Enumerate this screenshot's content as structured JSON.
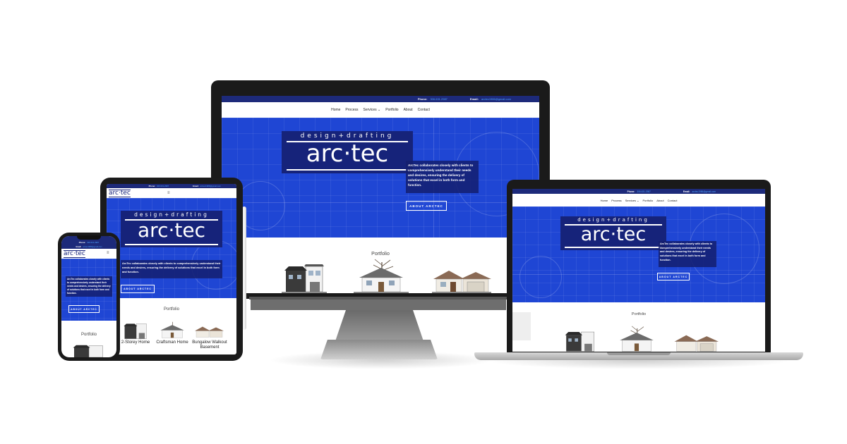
{
  "site": {
    "phone_label": "Phone:",
    "phone_value": "306.631.2987",
    "email_label": "Email:",
    "email_value": "arctec1986@gmail.com",
    "nav": [
      "Home",
      "Process",
      "Services ⌄",
      "Portfolio",
      "About",
      "Contact"
    ],
    "logo_tagline": "design+drafting",
    "logo_brand": "arc·tec",
    "blurb": "ArcTec collaborates closely with clients to comprehensively understand their needs and desires, ensuring the delivery of solutions that excel in both form and function.",
    "cta": "ABOUT ARCTEC",
    "portfolio_title": "Portfolio"
  },
  "portfolio_items": [
    "2-Storey Home",
    "Craftsman Home",
    "Bungalow Walkout Basement"
  ],
  "colors": {
    "hero_blue": "#1f46d4",
    "topbar": "#1d2a7a",
    "logo_bg": "#16237a",
    "link": "#4fa3ff"
  },
  "icons": [
    "hamburger-menu-icon"
  ]
}
